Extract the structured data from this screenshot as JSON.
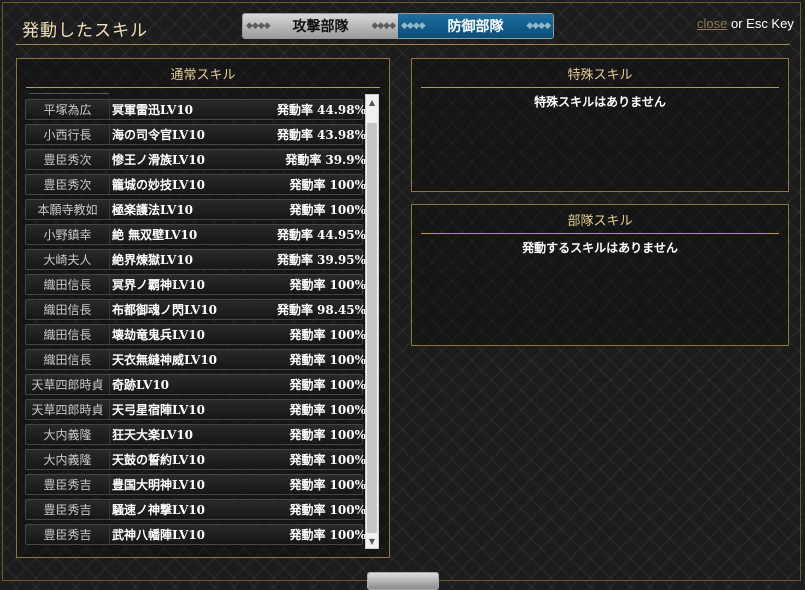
{
  "header": {
    "title": "発動したスキル",
    "tabs": [
      {
        "label": "攻撃部隊",
        "active": false
      },
      {
        "label": "防御部隊",
        "active": true
      }
    ],
    "tab_decoration": "◆◆◆◆",
    "close_link": "close",
    "close_suffix": " or Esc Key"
  },
  "normal_skills": {
    "heading": "通常スキル",
    "rate_label": "発動率",
    "rows": [
      {
        "name": "平塚為広",
        "skill": "冥軍雷迅LV10",
        "rate": "44.98%"
      },
      {
        "name": "小西行長",
        "skill": "海の司令官LV10",
        "rate": "43.98%"
      },
      {
        "name": "豊臣秀次",
        "skill": "惨王ノ滑族LV10",
        "rate": "39.9%"
      },
      {
        "name": "豊臣秀次",
        "skill": "籠城の妙技LV10",
        "rate": "100%"
      },
      {
        "name": "本願寺教如",
        "skill": "極楽護法LV10",
        "rate": "100%"
      },
      {
        "name": "小野鎮幸",
        "skill": "絶 無双壁LV10",
        "rate": "44.95%"
      },
      {
        "name": "大崎夫人",
        "skill": "絶界煉獄LV10",
        "rate": "39.95%"
      },
      {
        "name": "織田信長",
        "skill": "冥界ノ覇神LV10",
        "rate": "100%"
      },
      {
        "name": "織田信長",
        "skill": "布都御魂ノ閃LV10",
        "rate": "98.45%"
      },
      {
        "name": "織田信長",
        "skill": "壊劫竜鬼兵LV10",
        "rate": "100%"
      },
      {
        "name": "織田信長",
        "skill": "天衣無縫神威LV10",
        "rate": "100%"
      },
      {
        "name": "天草四郎時貞",
        "skill": "奇跡LV10",
        "rate": "100%"
      },
      {
        "name": "天草四郎時貞",
        "skill": "天弓星宿陣LV10",
        "rate": "100%"
      },
      {
        "name": "大内義隆",
        "skill": "狂天大楽LV10",
        "rate": "100%"
      },
      {
        "name": "大内義隆",
        "skill": "天鼓の誓約LV10",
        "rate": "100%"
      },
      {
        "name": "豊臣秀吉",
        "skill": "豊国大明神LV10",
        "rate": "100%"
      },
      {
        "name": "豊臣秀吉",
        "skill": "騒速ノ神撃LV10",
        "rate": "100%"
      },
      {
        "name": "豊臣秀吉",
        "skill": "武神八幡陣LV10",
        "rate": "100%"
      }
    ]
  },
  "special_skills": {
    "heading": "特殊スキル",
    "message": "特殊スキルはありません"
  },
  "unit_skills": {
    "heading": "部隊スキル",
    "message": "発動するスキルはありません"
  },
  "colors": {
    "accent_gold": "#b59c55",
    "active_tab": "#0a4d78",
    "inactive_tab": "#9a9a9a"
  }
}
